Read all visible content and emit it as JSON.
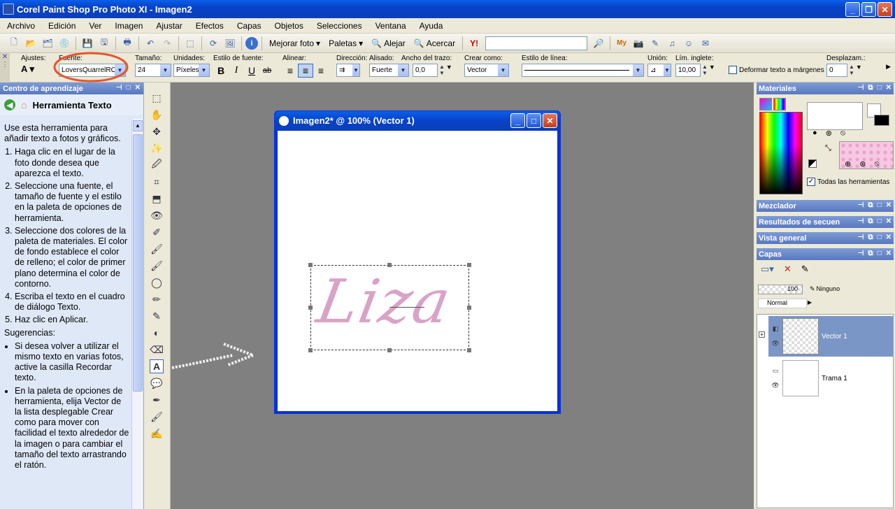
{
  "window": {
    "title": "Corel Paint Shop Pro Photo XI - Imagen2"
  },
  "menu": [
    "Archivo",
    "Edición",
    "Ver",
    "Imagen",
    "Ajustar",
    "Efectos",
    "Capas",
    "Objetos",
    "Selecciones",
    "Ventana",
    "Ayuda"
  ],
  "toolbar": {
    "enhance_photo": "Mejorar foto",
    "palettes": "Paletas",
    "zoom_out": "Alejar",
    "zoom_in": "Acercar"
  },
  "options": {
    "presets_label": "Ajustes:",
    "font_label": "Fuente:",
    "font_value": "LoversQuarrelROB",
    "size_label": "Tamaño:",
    "size_value": "24",
    "units_label": "Unidades:",
    "units_value": "Píxeles",
    "style_label": "Estilo de fuente:",
    "align_label": "Alinear:",
    "direction_label": "Dirección:",
    "antialias_label": "Alisado:",
    "antialias_value": "Fuerte",
    "stroke_label": "Ancho del trazo:",
    "stroke_value": "0,0",
    "create_label": "Crear como:",
    "create_value": "Vector",
    "linestyle_label": "Estilo de línea:",
    "join_label": "Unión:",
    "miter_label": "Lím. inglete:",
    "miter_value": "10,00",
    "warp_label": "Deformar texto a márgenes",
    "offset_label": "Desplazam.:",
    "offset_value": "0"
  },
  "learning": {
    "panel_title": "Centro de aprendizaje",
    "tool_title": "Herramienta Texto",
    "intro": "Use esta herramienta para añadir texto a fotos y gráficos.",
    "steps": [
      "Haga clic en el lugar de la foto donde desea que aparezca el texto.",
      "Seleccione una fuente, el tamaño de fuente y el estilo en la paleta de opciones de herramienta.",
      "Seleccione dos colores de la paleta de materiales. El color de fondo establece el color de relleno; el color de primer plano determina el color de contorno.",
      "Escriba el texto en el cuadro de diálogo Texto.",
      "Haz clic en Aplicar."
    ],
    "tips_label": "Sugerencias:",
    "tips": [
      "Si desea volver a utilizar el mismo texto en varias fotos, active la casilla Recordar texto.",
      "En la paleta de opciones de herramienta, elija Vector de la lista desplegable Crear como para mover con facilidad el texto alrededor de la imagen o para cambiar el tamaño del texto arrastrando el ratón."
    ]
  },
  "image_window": {
    "title": "Imagen2* @ 100% (Vector 1)",
    "text": "Liza"
  },
  "materials": {
    "title": "Materiales",
    "all_tools": "Todas las herramientas"
  },
  "panels": {
    "mixer": "Mezclador",
    "script_results": "Resultados de secuen",
    "overview": "Vista general",
    "layers": "Capas"
  },
  "layers": {
    "opacity": "100",
    "blend": "Normal",
    "mask": "Ninguno",
    "items": [
      {
        "name": "Vector 1"
      },
      {
        "name": "Trama 1"
      }
    ]
  },
  "colors": {
    "title_blue": "#0842c8",
    "annotation": "#e8542a",
    "text_pink": "#d9a3c8"
  }
}
